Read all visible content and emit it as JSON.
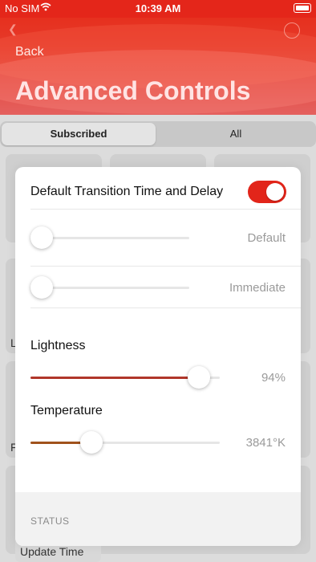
{
  "status_bar": {
    "carrier": "No SIM",
    "time": "10:39 AM"
  },
  "header": {
    "back_label": "Back",
    "title": "Advanced Controls"
  },
  "segment": {
    "options": [
      "Subscribed",
      "All"
    ],
    "selected": "Subscribed"
  },
  "background": {
    "peek_letters": [
      "L",
      "F"
    ],
    "update_time_label": "Update Time"
  },
  "modal": {
    "transition": {
      "label": "Default Transition Time and Delay",
      "enabled": true
    },
    "transition_time_slider": {
      "value_label": "Default",
      "level": 0
    },
    "delay_slider": {
      "value_label": "Immediate",
      "level": 0
    },
    "lightness": {
      "label": "Lightness",
      "value_label": "94%",
      "level": 0.94
    },
    "temperature": {
      "label": "Temperature",
      "value_label": "3841°K",
      "level": 0.3
    },
    "status_section_title": "STATUS"
  },
  "colors": {
    "accent": "#e2251a",
    "lightness_fill": "#b0362a",
    "temperature_fill": "#a0521c"
  }
}
